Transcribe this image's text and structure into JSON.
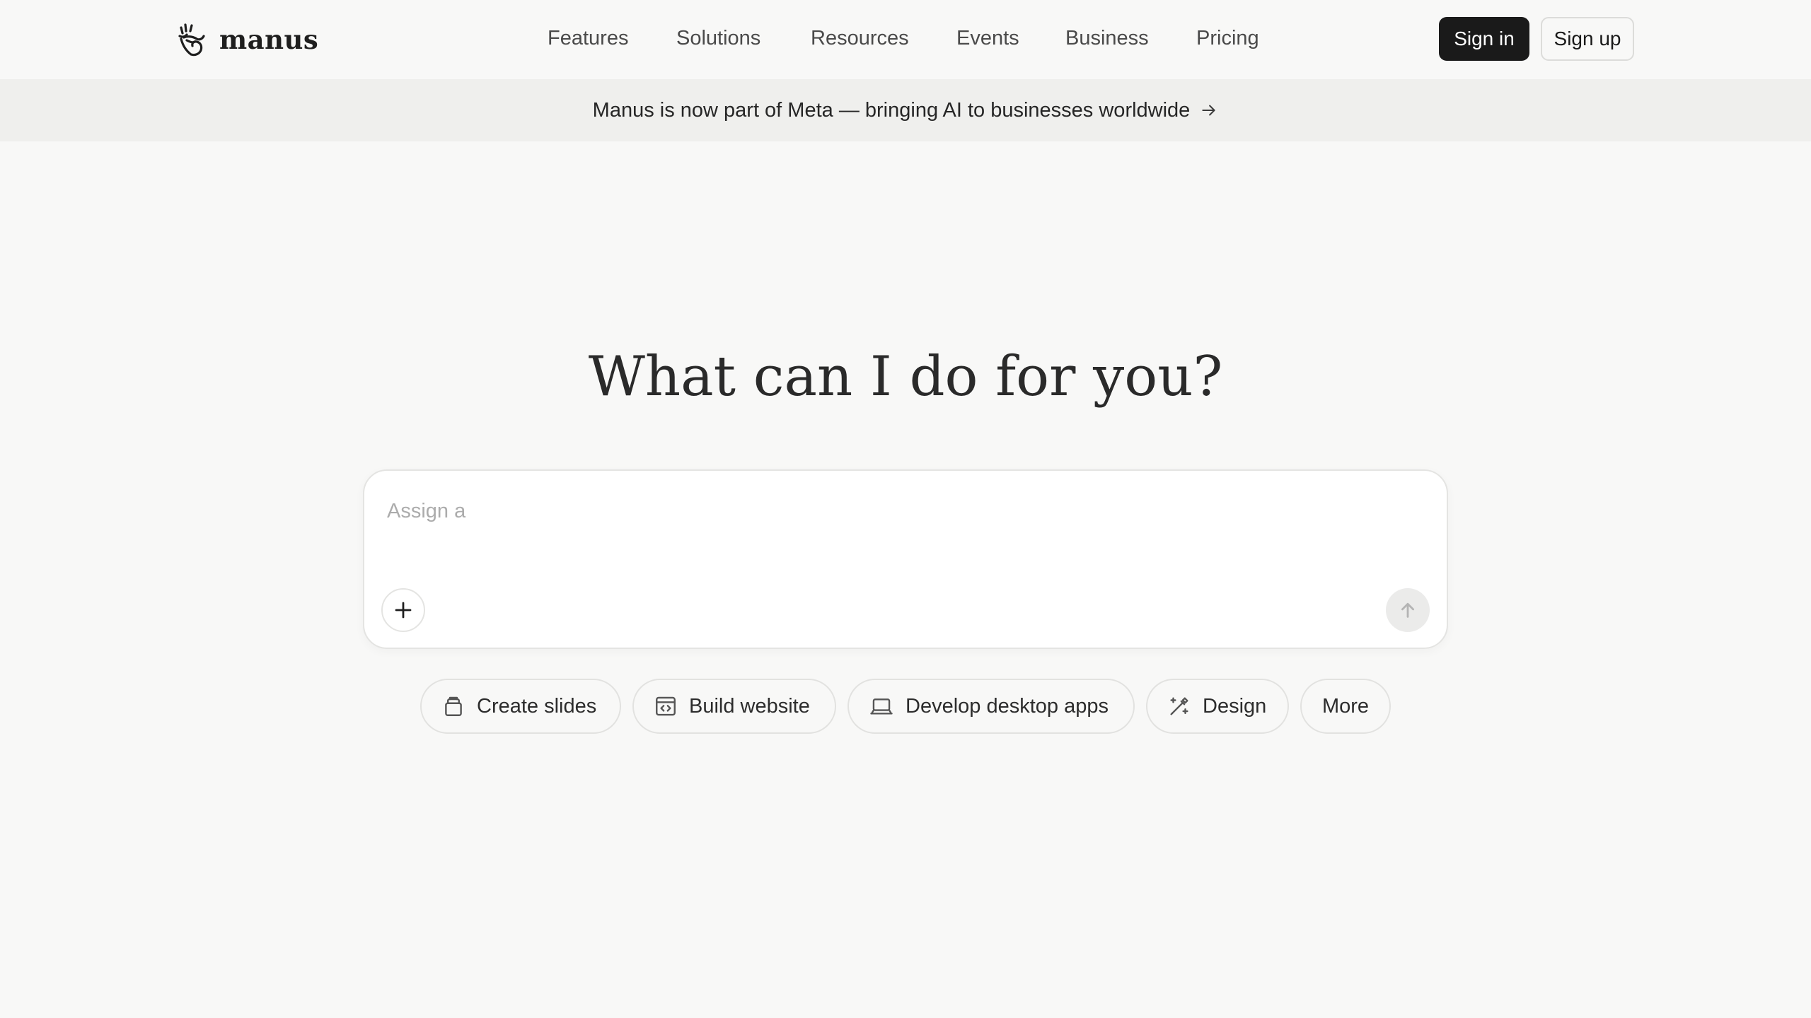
{
  "brand": {
    "name": "manus"
  },
  "nav": {
    "links": [
      "Features",
      "Solutions",
      "Resources",
      "Events",
      "Business",
      "Pricing"
    ],
    "sign_in": "Sign in",
    "sign_up": "Sign up"
  },
  "banner": {
    "text": "Manus is now part of Meta — bringing AI to businesses worldwide",
    "icon": "arrow-right-icon"
  },
  "hero": {
    "title": "What can I do for you?"
  },
  "prompt": {
    "placeholder": "Assign a",
    "value": "",
    "add_icon": "plus-icon",
    "send_icon": "arrow-up-icon"
  },
  "chips": [
    {
      "label": "Create slides",
      "icon": "slides-icon"
    },
    {
      "label": "Build website",
      "icon": "code-window-icon"
    },
    {
      "label": "Develop desktop apps",
      "icon": "laptop-icon"
    },
    {
      "label": "Design",
      "icon": "pen-sparkle-icon"
    },
    {
      "label": "More",
      "icon": ""
    }
  ],
  "colors": {
    "background": "#f8f8f7",
    "banner_bg": "#efefed",
    "primary_button": "#1a1a1a",
    "border": "#e2e2e0"
  }
}
